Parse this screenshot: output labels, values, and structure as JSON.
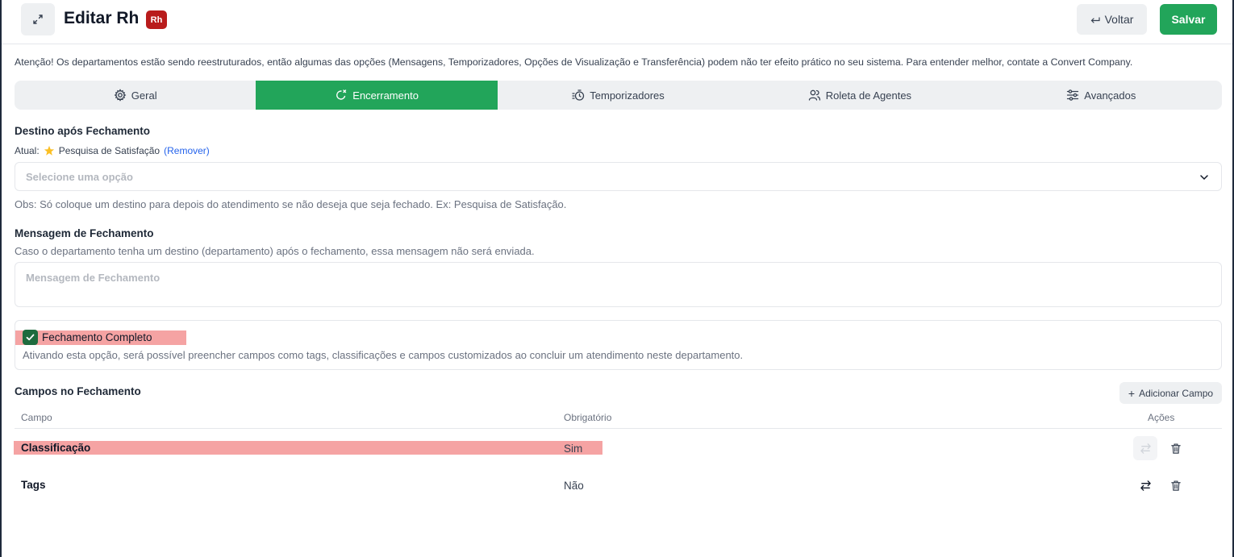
{
  "header": {
    "title": "Editar Rh",
    "badge": "Rh",
    "back_label": "Voltar",
    "save_label": "Salvar"
  },
  "notice": "Atenção! Os departamentos estão sendo reestruturados, então algumas das opções (Mensagens, Temporizadores, Opções de Visualização e Transferência) podem não ter efeito prático no seu sistema. Para entender melhor, contate a Convert Company.",
  "tabs": [
    {
      "label": "Geral",
      "icon": "gear-icon",
      "active": false
    },
    {
      "label": "Encerramento",
      "icon": "power-cycle-icon",
      "active": true
    },
    {
      "label": "Temporizadores",
      "icon": "timer-icon",
      "active": false
    },
    {
      "label": "Roleta de Agentes",
      "icon": "users-icon",
      "active": false
    },
    {
      "label": "Avançados",
      "icon": "sliders-icon",
      "active": false
    }
  ],
  "destino": {
    "title": "Destino após Fechamento",
    "current_prefix": "Atual:",
    "current_value": "Pesquisa de Satisfação",
    "remove_label": "(Remover)",
    "select_placeholder": "Selecione uma opção",
    "note": "Obs: Só coloque um destino para depois do atendimento se não deseja que seja fechado. Ex: Pesquisa de Satisfação."
  },
  "mensagem": {
    "title": "Mensagem de Fechamento",
    "description": "Caso o departamento tenha um destino (departamento) após o fechamento, essa mensagem não será enviada.",
    "placeholder": "Mensagem de Fechamento"
  },
  "fechamento_completo": {
    "label": "Fechamento Completo",
    "checked": true,
    "description": "Ativando esta opção, será possível preencher campos como tags, classificações e campos customizados ao concluir um atendimento neste departamento."
  },
  "campos": {
    "title": "Campos no Fechamento",
    "add_label": "Adicionar Campo",
    "columns": [
      "Campo",
      "Obrigatório",
      "Ações"
    ],
    "rows": [
      {
        "campo": "Classificação",
        "obrigatorio": "Sim",
        "toggle_disabled": true
      },
      {
        "campo": "Tags",
        "obrigatorio": "Não",
        "toggle_disabled": false
      }
    ]
  },
  "colors": {
    "accent": "#22a55a",
    "badge": "#b91c1c",
    "highlight": "#f5a3a3",
    "link": "#2563eb"
  }
}
